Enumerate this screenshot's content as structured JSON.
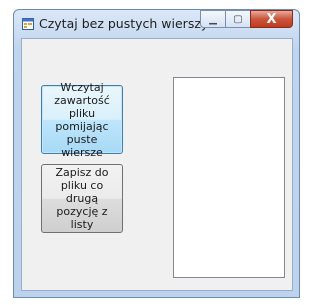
{
  "window": {
    "title": "Czytaj bez pustych wierszy",
    "minimize_glyph": "▁",
    "maximize_glyph": "▢",
    "close_glyph": "X",
    "app_icon": "windows-form-icon"
  },
  "buttons": {
    "read_label": "Wczytaj zawartość pliku pomijając puste wiersze",
    "save_label": "Zapisz do pliku co drugą pozycję z listy"
  },
  "listbox": {
    "items": []
  },
  "colors": {
    "title_bar": "#bfd4ee",
    "client_background": "#f0f0f0",
    "close_button": "#c8563d",
    "focused_button": "#bee6fd"
  }
}
